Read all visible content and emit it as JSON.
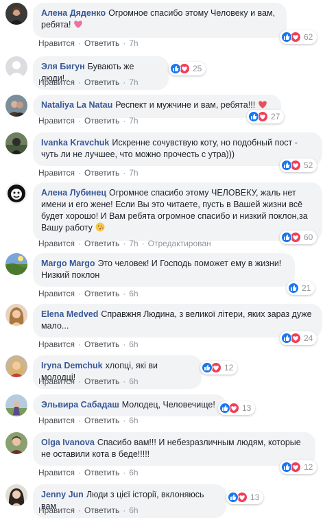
{
  "labels": {
    "like": "Нравится",
    "reply": "Ответить",
    "dot": "·",
    "edited": "Отредактирован"
  },
  "colors": {
    "author": "#385898",
    "bubble": "#f2f3f5",
    "like": "#1877f2",
    "love": "#f33e58",
    "meta": "#90949c"
  },
  "comments": [
    {
      "author": "Алена Дяденко",
      "text": "Огромное спасибо этому Человеку и вам, ребята!",
      "emoji": "heart-icon",
      "time": "7h",
      "reactions": "62"
    },
    {
      "author": "Эля Бигун",
      "text": "Бувають же люди!..",
      "time": "7h",
      "reactions": "25"
    },
    {
      "author": "Nataliya La Natau",
      "text": "Респект и мужчине и вам, ребята!!!",
      "emoji": "heart-icon",
      "time": "7h",
      "reactions": "27"
    },
    {
      "author": "Ivanka Kravchuk",
      "text": "Искренне сочувствую коту, но подобный пост - чуть ли не лучшее, что можно прочесть с утра)))",
      "time": "7h",
      "reactions": "52"
    },
    {
      "author": "Алена Лубинец",
      "text": "Огромное спасибо этому ЧЕЛОВЕКУ, жаль нет имени и его жене! Если Вы это читаете, пусть в Вашей жизни всё будет хорошо! И Вам ребята огромное спасибо и низкий поклон,за Вашу работу",
      "emoji": "kiss-icon",
      "time": "7h",
      "edited": true,
      "reactions": "60"
    },
    {
      "author": "Margo Margo",
      "text": "Это человек! И Господь поможет ему в жизни! Низкий поклон",
      "time": "6h",
      "reactions": "21"
    },
    {
      "author": "Elena Medved",
      "text": "Справжня Людина, з великої літери, яких зараз дуже мало...",
      "time": "6h",
      "reactions": "24"
    },
    {
      "author": "Iryna Demchuk",
      "text": "хлопці, які ви молодці!",
      "time": "6h",
      "reactions": "12"
    },
    {
      "author": "Эльвира Сабадаш",
      "text": "Молодец, Человечище!",
      "time": "6h",
      "reactions": "13"
    },
    {
      "author": "Olga Ivanova",
      "text": "Спасибо вам!!! И небезразличным людям, которые не оставили кота в беде!!!!!",
      "time": "6h",
      "reactions": "12"
    },
    {
      "author": "Jenny Jun",
      "text": "Люди з цієї історії, вклоняюсь вам",
      "time": "6h",
      "reactions": "13"
    }
  ]
}
